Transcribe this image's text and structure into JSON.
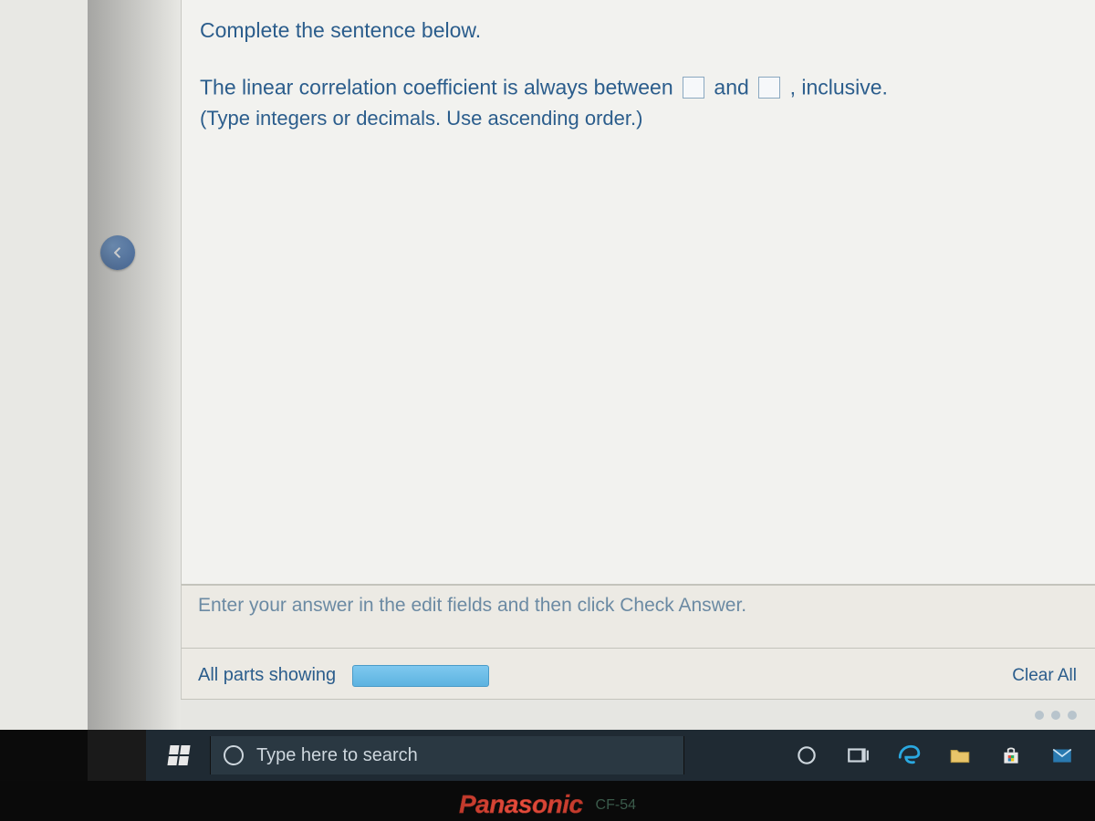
{
  "question": {
    "title": "Complete the sentence below.",
    "segments": {
      "s1": "The linear correlation coefficient is always between ",
      "s2": " and ",
      "s3": ", inclusive."
    },
    "hint": "(Type integers or decimals. Use ascending order.)"
  },
  "footer": {
    "instruction": "Enter your answer in the edit fields and then click Check Answer.",
    "parts_label": "All parts showing",
    "clear_label": "Clear All"
  },
  "taskbar": {
    "search_placeholder": "Type here to search"
  },
  "device": {
    "brand": "Panasonic",
    "model": "CF-54"
  }
}
